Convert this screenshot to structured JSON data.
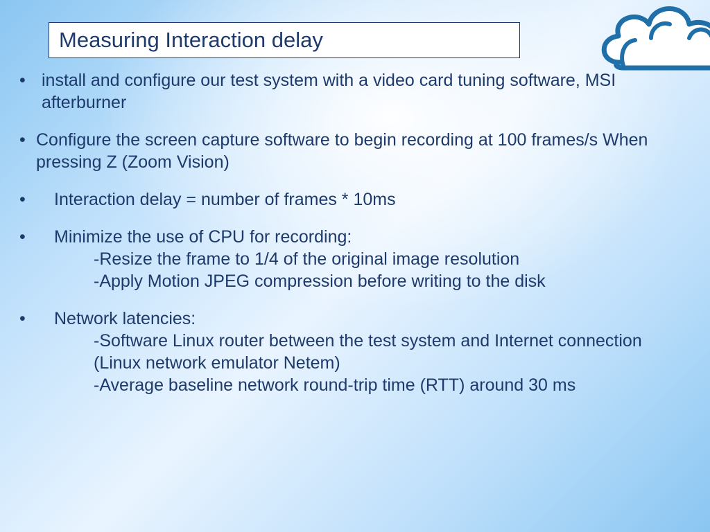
{
  "title": "Measuring Interaction delay",
  "bullets": {
    "b1": "install and configure our test system with a video card tuning software, MSI afterburner",
    "b2": "Configure the screen capture software to begin recording at 100 frames/s When pressing Z (Zoom Vision)",
    "b3": "Interaction delay = number of frames * 10ms",
    "b4": "Minimize the use of CPU for recording:",
    "b4_sub1": "-Resize the frame to 1/4 of the original image resolution",
    "b4_sub2": "-Apply Motion JPEG compression before writing to the disk",
    "b5": "Network latencies:",
    "b5_sub1": "-Software Linux router between the test system and Internet connection (Linux network emulator Netem)",
    "b5_sub2": "-Average baseline network round-trip time (RTT) around 30 ms"
  }
}
